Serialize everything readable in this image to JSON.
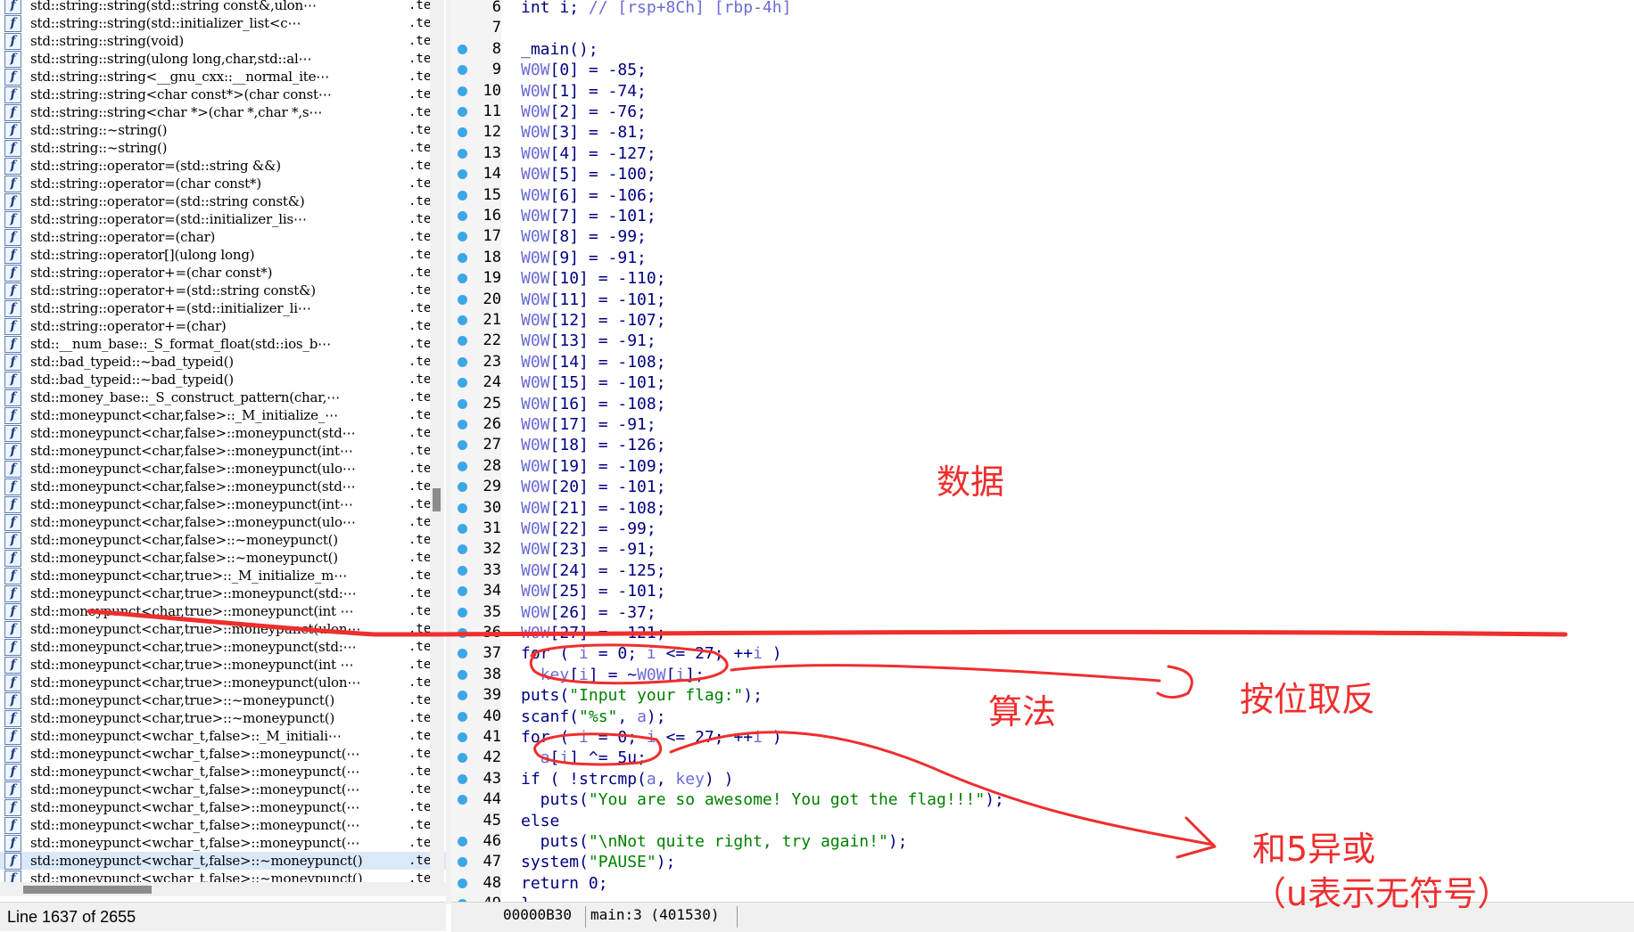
{
  "functions_panel": {
    "segment_label": ".te",
    "items": [
      {
        "name": "std::string::string(std::string const&,ulon⋯"
      },
      {
        "name": "std::string::string(std::initializer_list<c⋯"
      },
      {
        "name": "std::string::string(void)"
      },
      {
        "name": "std::string::string(ulong long,char,std::al⋯"
      },
      {
        "name": "std::string::string<__gnu_cxx::__normal_ite⋯"
      },
      {
        "name": "std::string::string<char const*>(char const⋯"
      },
      {
        "name": "std::string::string<char *>(char *,char *,s⋯"
      },
      {
        "name": "std::string::~string()"
      },
      {
        "name": "std::string::~string()"
      },
      {
        "name": "std::string::operator=(std::string &&)"
      },
      {
        "name": "std::string::operator=(char const*)"
      },
      {
        "name": "std::string::operator=(std::string const&)"
      },
      {
        "name": "std::string::operator=(std::initializer_lis⋯"
      },
      {
        "name": "std::string::operator=(char)"
      },
      {
        "name": "std::string::operator[](ulong long)"
      },
      {
        "name": "std::string::operator+=(char const*)"
      },
      {
        "name": "std::string::operator+=(std::string const&)"
      },
      {
        "name": "std::string::operator+=(std::initializer_li⋯"
      },
      {
        "name": "std::string::operator+=(char)"
      },
      {
        "name": "std::__num_base::_S_format_float(std::ios_b⋯"
      },
      {
        "name": "std::bad_typeid::~bad_typeid()"
      },
      {
        "name": "std::bad_typeid::~bad_typeid()"
      },
      {
        "name": "std::money_base::_S_construct_pattern(char,⋯"
      },
      {
        "name": "std::moneypunct<char,false>::_M_initialize_⋯"
      },
      {
        "name": "std::moneypunct<char,false>::moneypunct(std⋯"
      },
      {
        "name": "std::moneypunct<char,false>::moneypunct(int⋯"
      },
      {
        "name": "std::moneypunct<char,false>::moneypunct(ulo⋯"
      },
      {
        "name": "std::moneypunct<char,false>::moneypunct(std⋯"
      },
      {
        "name": "std::moneypunct<char,false>::moneypunct(int⋯"
      },
      {
        "name": "std::moneypunct<char,false>::moneypunct(ulo⋯"
      },
      {
        "name": "std::moneypunct<char,false>::~moneypunct()"
      },
      {
        "name": "std::moneypunct<char,false>::~moneypunct()"
      },
      {
        "name": "std::moneypunct<char,true>::_M_initialize_m⋯"
      },
      {
        "name": "std::moneypunct<char,true>::moneypunct(std:⋯"
      },
      {
        "name": "std::moneypunct<char,true>::moneypunct(int ⋯"
      },
      {
        "name": "std::moneypunct<char,true>::moneypunct(ulon⋯"
      },
      {
        "name": "std::moneypunct<char,true>::moneypunct(std:⋯"
      },
      {
        "name": "std::moneypunct<char,true>::moneypunct(int ⋯"
      },
      {
        "name": "std::moneypunct<char,true>::moneypunct(ulon⋯"
      },
      {
        "name": "std::moneypunct<char,true>::~moneypunct()"
      },
      {
        "name": "std::moneypunct<char,true>::~moneypunct()"
      },
      {
        "name": "std::moneypunct<wchar_t,false>::_M_initiali⋯"
      },
      {
        "name": "std::moneypunct<wchar_t,false>::moneypunct(⋯"
      },
      {
        "name": "std::moneypunct<wchar_t,false>::moneypunct(⋯"
      },
      {
        "name": "std::moneypunct<wchar_t,false>::moneypunct(⋯"
      },
      {
        "name": "std::moneypunct<wchar_t,false>::moneypunct(⋯"
      },
      {
        "name": "std::moneypunct<wchar_t,false>::moneypunct(⋯"
      },
      {
        "name": "std::moneypunct<wchar_t,false>::moneypunct(⋯"
      },
      {
        "name": "std::moneypunct<wchar_t,false>::~moneypunct()",
        "selected": true
      },
      {
        "name": "std::moneypunct<wchar_t,false>::~moneypunct()"
      }
    ]
  },
  "status_left": {
    "line_info": "Line 1637 of 2655"
  },
  "code_view": {
    "lines": [
      {
        "num": "6",
        "bp": false,
        "text": "int i; // [rsp+8Ch] [rbp-4h]"
      },
      {
        "num": "7",
        "bp": false,
        "text": ""
      },
      {
        "num": "8",
        "bp": true,
        "text": "_main();"
      },
      {
        "num": "9",
        "bp": true,
        "text": "W0W[0] = -85;"
      },
      {
        "num": "10",
        "bp": true,
        "text": "W0W[1] = -74;"
      },
      {
        "num": "11",
        "bp": true,
        "text": "W0W[2] = -76;"
      },
      {
        "num": "12",
        "bp": true,
        "text": "W0W[3] = -81;"
      },
      {
        "num": "13",
        "bp": true,
        "text": "W0W[4] = -127;"
      },
      {
        "num": "14",
        "bp": true,
        "text": "W0W[5] = -100;"
      },
      {
        "num": "15",
        "bp": true,
        "text": "W0W[6] = -106;"
      },
      {
        "num": "16",
        "bp": true,
        "text": "W0W[7] = -101;"
      },
      {
        "num": "17",
        "bp": true,
        "text": "W0W[8] = -99;"
      },
      {
        "num": "18",
        "bp": true,
        "text": "W0W[9] = -91;"
      },
      {
        "num": "19",
        "bp": true,
        "text": "W0W[10] = -110;"
      },
      {
        "num": "20",
        "bp": true,
        "text": "W0W[11] = -101;"
      },
      {
        "num": "21",
        "bp": true,
        "text": "W0W[12] = -107;"
      },
      {
        "num": "22",
        "bp": true,
        "text": "W0W[13] = -91;"
      },
      {
        "num": "23",
        "bp": true,
        "text": "W0W[14] = -108;"
      },
      {
        "num": "24",
        "bp": true,
        "text": "W0W[15] = -101;"
      },
      {
        "num": "25",
        "bp": true,
        "text": "W0W[16] = -108;"
      },
      {
        "num": "26",
        "bp": true,
        "text": "W0W[17] = -91;"
      },
      {
        "num": "27",
        "bp": true,
        "text": "W0W[18] = -126;"
      },
      {
        "num": "28",
        "bp": true,
        "text": "W0W[19] = -109;"
      },
      {
        "num": "29",
        "bp": true,
        "text": "W0W[20] = -101;"
      },
      {
        "num": "30",
        "bp": true,
        "text": "W0W[21] = -108;"
      },
      {
        "num": "31",
        "bp": true,
        "text": "W0W[22] = -99;"
      },
      {
        "num": "32",
        "bp": true,
        "text": "W0W[23] = -91;"
      },
      {
        "num": "33",
        "bp": true,
        "text": "W0W[24] = -125;"
      },
      {
        "num": "34",
        "bp": true,
        "text": "W0W[25] = -101;"
      },
      {
        "num": "35",
        "bp": true,
        "text": "W0W[26] = -37;"
      },
      {
        "num": "36",
        "bp": true,
        "text": "W0W[27] = -121;"
      },
      {
        "num": "37",
        "bp": true,
        "text": "for ( i = 0; i <= 27; ++i )"
      },
      {
        "num": "38",
        "bp": true,
        "text": "  key[i] = ~W0W[i];"
      },
      {
        "num": "39",
        "bp": true,
        "text": "puts(\"Input your flag:\");"
      },
      {
        "num": "40",
        "bp": true,
        "text": "scanf(\"%s\", a);"
      },
      {
        "num": "41",
        "bp": true,
        "text": "for ( i = 0; i <= 27; ++i )"
      },
      {
        "num": "42",
        "bp": true,
        "text": "  a[i] ^= 5u;"
      },
      {
        "num": "43",
        "bp": true,
        "text": "if ( !strcmp(a, key) )"
      },
      {
        "num": "44",
        "bp": true,
        "text": "  puts(\"You are so awesome! You got the flag!!!\");"
      },
      {
        "num": "45",
        "bp": false,
        "text": "else"
      },
      {
        "num": "46",
        "bp": true,
        "text": "  puts(\"\\nNot quite right, try again!\");"
      },
      {
        "num": "47",
        "bp": true,
        "text": "system(\"PAUSE\");"
      },
      {
        "num": "48",
        "bp": true,
        "text": "return 0;"
      },
      {
        "num": "49",
        "bp": true,
        "text": "}"
      }
    ]
  },
  "status_right": {
    "address": "00000B30",
    "location": "main:3 (401530)"
  },
  "annotations": {
    "data_label": "数据",
    "algorithm_label": "算法",
    "bitwise_not_label": "按位取反",
    "xor_label": "和5异或",
    "unsigned_note": "（u表示无符号）"
  },
  "colors": {
    "annotation_red": "#ef2e2e",
    "breakpoint_blue": "#3ba7e6",
    "code_navy": "#000080",
    "variable_purple": "#6b6bd6",
    "string_green": "#008000"
  }
}
